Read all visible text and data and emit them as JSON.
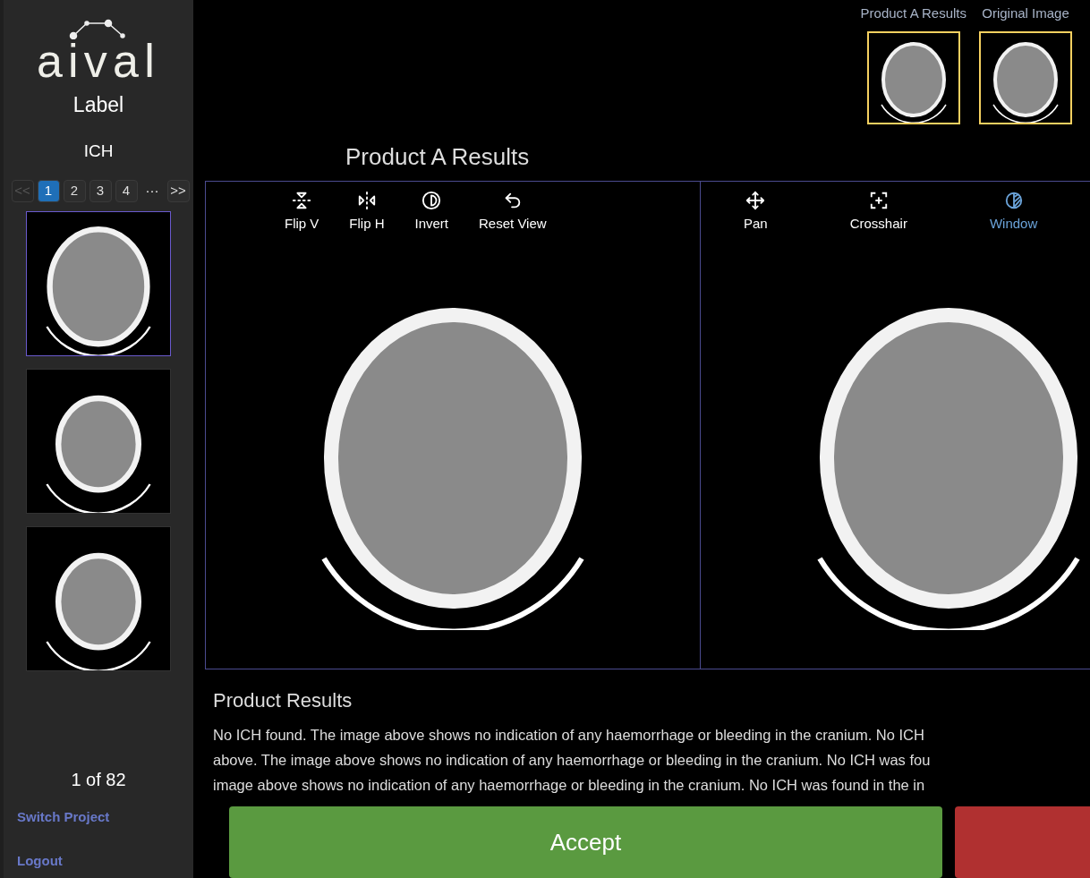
{
  "sidebar": {
    "logo": "aival",
    "product": "Label",
    "project": "ICH",
    "pagination": [
      {
        "label": "<<",
        "kind": "nav",
        "disabled": true
      },
      {
        "label": "1",
        "kind": "page",
        "selected": true
      },
      {
        "label": "2",
        "kind": "page",
        "selected": false
      },
      {
        "label": "3",
        "kind": "page",
        "selected": false
      },
      {
        "label": "4",
        "kind": "page",
        "selected": false
      },
      {
        "label": "···",
        "kind": "gap"
      },
      {
        "label": ">>",
        "kind": "nav",
        "disabled": false
      }
    ],
    "thumbnails": [
      {
        "selected": true
      },
      {
        "selected": false
      },
      {
        "selected": false
      }
    ],
    "counter": "1 of 82",
    "links": [
      "Switch Project",
      "Logout"
    ]
  },
  "previews": [
    {
      "label": "Product A Results",
      "selected": true
    },
    {
      "label": "Original Image",
      "selected": true
    }
  ],
  "viewer_title": "Product A Results",
  "viewers": [
    {
      "tools": [
        {
          "kind": "flip-v",
          "label": "Flip V",
          "selected": false
        },
        {
          "kind": "flip-h",
          "label": "Flip H",
          "selected": false
        },
        {
          "kind": "invert",
          "label": "Invert",
          "selected": false
        },
        {
          "kind": "reset",
          "label": "Reset View",
          "selected": false
        }
      ]
    },
    {
      "tools": [
        {
          "kind": "pan",
          "label": "Pan",
          "selected": false
        },
        {
          "kind": "crosshair",
          "label": "Crosshair",
          "selected": false
        },
        {
          "kind": "window",
          "label": "Window",
          "selected": true
        }
      ]
    }
  ],
  "results": {
    "title": "Product Results",
    "lines": [
      "No ICH found. The image above shows no indication of any haemorrhage or bleeding in the cranium. No ICH",
      "above. The image above shows no indication of any haemorrhage or bleeding in the cranium. No ICH was fou",
      "image above shows no indication of any haemorrhage or bleeding in the cranium. No ICH was found in the in"
    ]
  },
  "actions": [
    {
      "kind": "accept",
      "label": "Accept"
    },
    {
      "kind": "reject"
    }
  ]
}
